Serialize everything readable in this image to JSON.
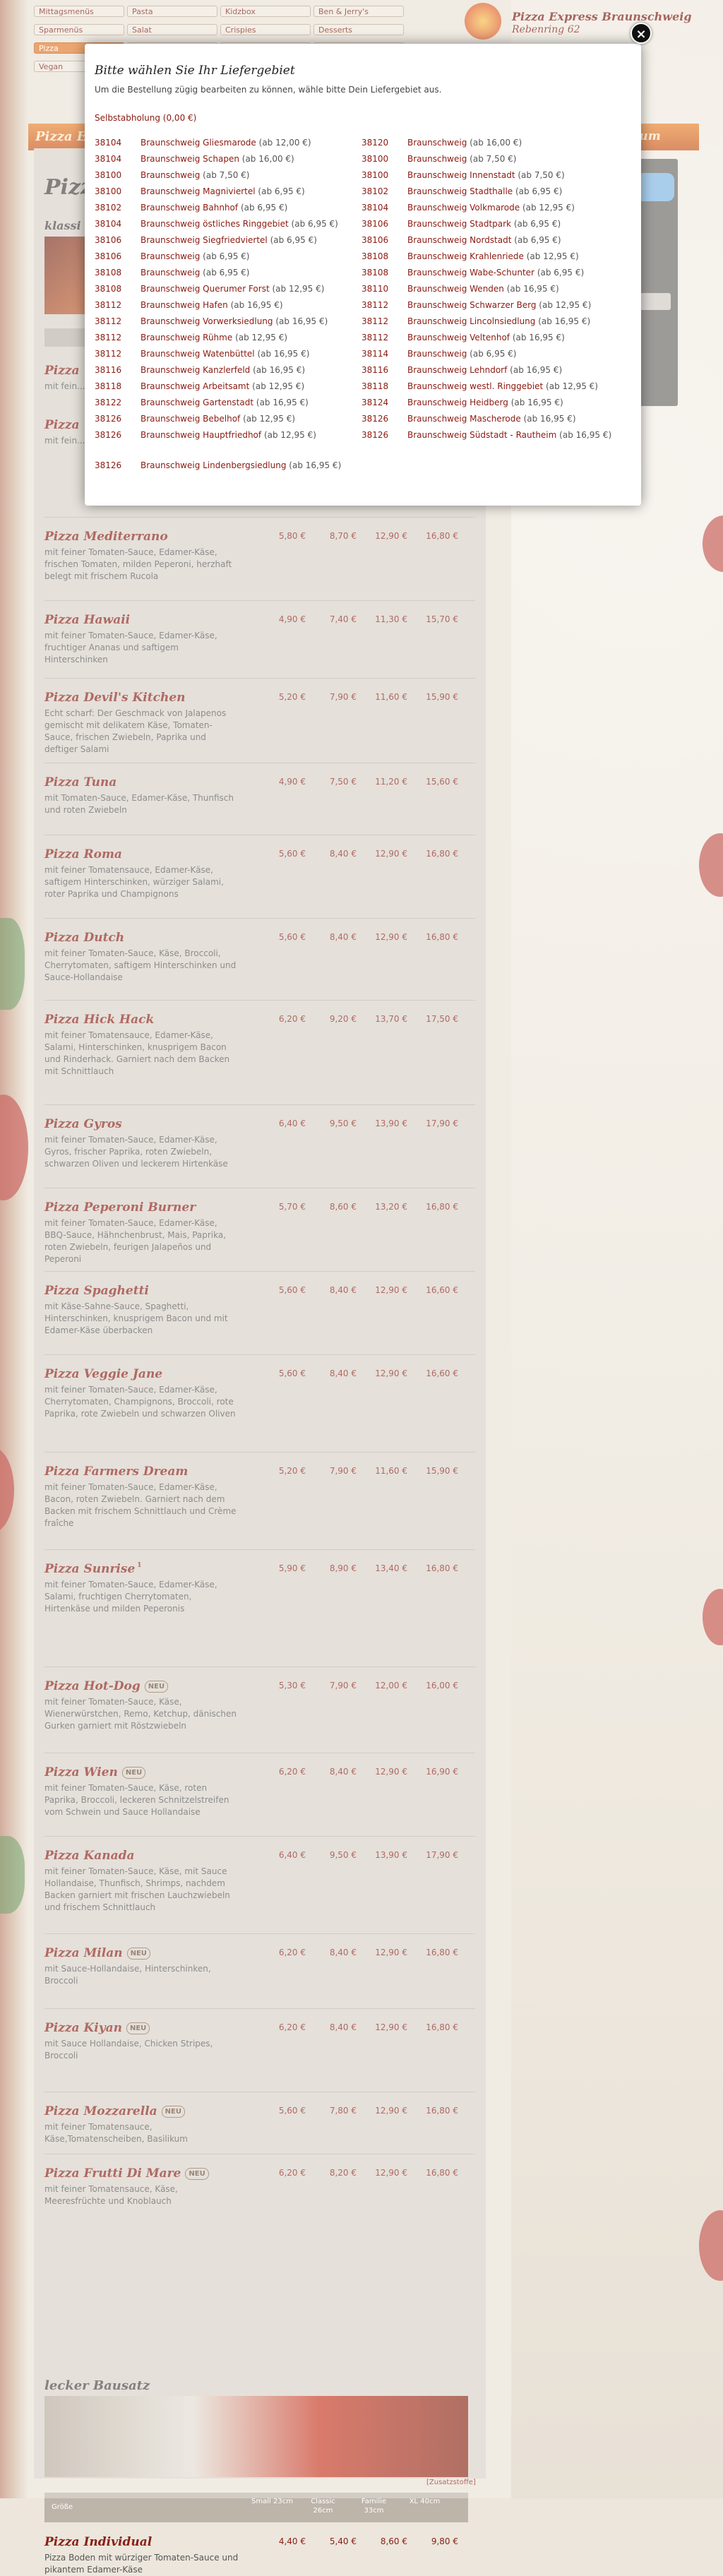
{
  "header": {
    "brand_name": "Pizza Express Braunschweig",
    "brand_street": "Rebenring 62",
    "menu": [
      "Mittagsmenüs",
      "Pasta",
      "Kidzbox",
      "Ben & Jerry's",
      "Sparmenüs",
      "Salat",
      "Crispies",
      "Desserts",
      "Pizza",
      "",
      "",
      "",
      "Vegan",
      "",
      "",
      ""
    ],
    "active_menu": "Pizza",
    "band_title": "Pizza E",
    "band_right": "reissum"
  },
  "modal": {
    "title": "Bitte wählen Sie Ihr Liefergebiet",
    "subtitle": "Um die Bestellung zügig bearbeiten zu können, wähle bitte Dein Liefergebiet aus.",
    "pickup": "Selbstabholung (0,00 €)",
    "close_symbol": "×",
    "left_column": [
      {
        "zip": "38104",
        "city": "Braunschweig Gliesmarode",
        "min": "(ab 12,00 €)"
      },
      {
        "zip": "38104",
        "city": "Braunschweig Schapen",
        "min": "(ab 16,00 €)"
      },
      {
        "zip": "38100",
        "city": "Braunschweig",
        "min": "(ab 7,50 €)"
      },
      {
        "zip": "38100",
        "city": "Braunschweig Magniviertel",
        "min": "(ab 6,95 €)"
      },
      {
        "zip": "38102",
        "city": "Braunschweig Bahnhof",
        "min": "(ab 6,95 €)"
      },
      {
        "zip": "38104",
        "city": "Braunschweig östliches Ringgebiet",
        "min": "(ab 6,95 €)"
      },
      {
        "zip": "38106",
        "city": "Braunschweig Siegfriedviertel",
        "min": "(ab 6,95 €)"
      },
      {
        "zip": "38106",
        "city": "Braunschweig",
        "min": "(ab 6,95 €)"
      },
      {
        "zip": "38108",
        "city": "Braunschweig",
        "min": "(ab 6,95 €)"
      },
      {
        "zip": "38108",
        "city": "Braunschweig Querumer Forst",
        "min": "(ab 12,95 €)"
      },
      {
        "zip": "38112",
        "city": "Braunschweig Hafen",
        "min": "(ab 16,95 €)"
      },
      {
        "zip": "38112",
        "city": "Braunschweig Vorwerksiedlung",
        "min": "(ab 16,95 €)"
      },
      {
        "zip": "38112",
        "city": "Braunschweig Rühme",
        "min": "(ab 12,95 €)"
      },
      {
        "zip": "38112",
        "city": "Braunschweig Watenbüttel",
        "min": "(ab 16,95 €)"
      },
      {
        "zip": "38116",
        "city": "Braunschweig Kanzlerfeld",
        "min": "(ab 16,95 €)"
      },
      {
        "zip": "38118",
        "city": "Braunschweig Arbeitsamt",
        "min": "(ab 12,95 €)"
      },
      {
        "zip": "38122",
        "city": "Braunschweig Gartenstadt",
        "min": "(ab 16,95 €)"
      },
      {
        "zip": "38126",
        "city": "Braunschweig Bebelhof",
        "min": "(ab 12,95 €)"
      },
      {
        "zip": "38126",
        "city": "Braunschweig Hauptfriedhof",
        "min": "(ab 12,95 €)"
      },
      {
        "zip": "38126",
        "city": "Braunschweig Lindenbergsiedlung",
        "min": "(ab 16,95 €)"
      }
    ],
    "right_column": [
      {
        "zip": "38120",
        "city": "Braunschweig",
        "min": "(ab 16,00 €)"
      },
      {
        "zip": "38100",
        "city": "Braunschweig",
        "min": "(ab 7,50 €)"
      },
      {
        "zip": "38100",
        "city": "Braunschweig Innenstadt",
        "min": "(ab 7,50 €)"
      },
      {
        "zip": "38102",
        "city": "Braunschweig Stadthalle",
        "min": "(ab 6,95 €)"
      },
      {
        "zip": "38104",
        "city": "Braunschweig Volkmarode",
        "min": "(ab 12,95 €)"
      },
      {
        "zip": "38106",
        "city": "Braunschweig Stadtpark",
        "min": "(ab 6,95 €)"
      },
      {
        "zip": "38106",
        "city": "Braunschweig Nordstadt",
        "min": "(ab 6,95 €)"
      },
      {
        "zip": "38108",
        "city": "Braunschweig Krahlenriede",
        "min": "(ab 12,95 €)"
      },
      {
        "zip": "38108",
        "city": "Braunschweig Wabe-Schunter",
        "min": "(ab 6,95 €)"
      },
      {
        "zip": "38110",
        "city": "Braunschweig Wenden",
        "min": "(ab 16,95 €)"
      },
      {
        "zip": "38112",
        "city": "Braunschweig Schwarzer Berg",
        "min": "(ab 12,95 €)"
      },
      {
        "zip": "38112",
        "city": "Braunschweig Lincolnsiedlung",
        "min": "(ab 16,95 €)"
      },
      {
        "zip": "38112",
        "city": "Braunschweig Veltenhof",
        "min": "(ab 16,95 €)"
      },
      {
        "zip": "38114",
        "city": "Braunschweig",
        "min": "(ab 6,95 €)"
      },
      {
        "zip": "38116",
        "city": "Braunschweig Lehndorf",
        "min": "(ab 16,95 €)"
      },
      {
        "zip": "38118",
        "city": "Braunschweig westl. Ringgebiet",
        "min": "(ab 12,95 €)"
      },
      {
        "zip": "38124",
        "city": "Braunschweig Heidberg",
        "min": "(ab 16,95 €)"
      },
      {
        "zip": "38126",
        "city": "Braunschweig Mascherode",
        "min": "(ab 16,95 €)"
      },
      {
        "zip": "38126",
        "city": "Braunschweig Südstadt - Rautheim",
        "min": "(ab 16,95 €)"
      }
    ]
  },
  "main": {
    "title": "Pizza",
    "subtitle": "klassi",
    "items": [
      {
        "name": "Pizza",
        "neu": false,
        "sup": "",
        "desc": "mit fein... mit ent...",
        "prices": [
          "",
          "",
          "",
          ""
        ]
      },
      {
        "name": "Pizza",
        "neu": false,
        "sup": "",
        "desc": "mit fein... deftiger ... Peperon...",
        "prices": [
          "",
          "",
          "",
          ""
        ]
      },
      {
        "name": "Pizza Mediterrano",
        "neu": false,
        "sup": "",
        "desc": "mit feiner Tomaten-Sauce, Edamer-Käse, frischen Tomaten, milden Peperoni, herzhaft belegt mit frischem Rucola",
        "prices": [
          "5,80 €",
          "8,70 €",
          "12,90 €",
          "16,80 €"
        ]
      },
      {
        "name": "Pizza Hawaii",
        "neu": false,
        "sup": "",
        "desc": "mit feiner Tomaten-Sauce, Edamer-Käse, fruchtiger Ananas und saftigem Hinterschinken",
        "prices": [
          "4,90 €",
          "7,40 €",
          "11,30 €",
          "15,70 €"
        ]
      },
      {
        "name": "Pizza Devil's Kitchen",
        "neu": false,
        "sup": "",
        "desc": "Echt scharf: Der Geschmack von Jalapenos gemischt mit delikatem Käse, Tomaten-Sauce, frischen Zwiebeln, Paprika und deftiger Salami",
        "prices": [
          "5,20 €",
          "7,90 €",
          "11,60 €",
          "15,90 €"
        ]
      },
      {
        "name": "Pizza Tuna",
        "neu": false,
        "sup": "",
        "desc": "mit Tomaten-Sauce, Edamer-Käse, Thunfisch und roten Zwiebeln",
        "prices": [
          "4,90 €",
          "7,50 €",
          "11,20 €",
          "15,60 €"
        ]
      },
      {
        "name": "Pizza Roma",
        "neu": false,
        "sup": "",
        "desc": "mit feiner Tomatensauce, Edamer-Käse, saftigem Hinterschinken, würziger Salami, roter Paprika und Champignons",
        "prices": [
          "5,60 €",
          "8,40 €",
          "12,90 €",
          "16,80 €"
        ]
      },
      {
        "name": "Pizza Dutch",
        "neu": false,
        "sup": "",
        "desc": "mit feiner Tomaten-Sauce, Käse, Broccoli, Cherrytomaten, saftigem Hinterschinken und Sauce-Hollandaise",
        "prices": [
          "5,60 €",
          "8,40 €",
          "12,90 €",
          "16,80 €"
        ]
      },
      {
        "name": "Pizza Hick Hack",
        "neu": false,
        "sup": "",
        "desc": "mit feiner Tomatensauce, Edamer-Käse, Salami, Hinterschinken, knusprigem Bacon und Rinderhack. Garniert nach dem Backen mit Schnittlauch",
        "prices": [
          "6,20 €",
          "9,20 €",
          "13,70 €",
          "17,50 €"
        ]
      },
      {
        "name": "Pizza Gyros",
        "neu": false,
        "sup": "",
        "desc": "mit feiner Tomaten-Sauce, Edamer-Käse, Gyros, frischer Paprika, roten Zwiebeln, schwarzen Oliven und leckerem Hirtenkäse",
        "prices": [
          "6,40 €",
          "9,50 €",
          "13,90 €",
          "17,90 €"
        ]
      },
      {
        "name": "Pizza Peperoni Burner",
        "neu": false,
        "sup": "",
        "desc": "mit feiner Tomaten-Sauce, Edamer-Käse, BBQ-Sauce, Hähnchenbrust, Mais, Paprika, roten Zwiebeln, feurigen Jalapeños und Peperoni",
        "prices": [
          "5,70 €",
          "8,60 €",
          "13,20 €",
          "16,80 €"
        ]
      },
      {
        "name": "Pizza Spaghetti",
        "neu": false,
        "sup": "",
        "desc": "mit Käse-Sahne-Sauce, Spaghetti, Hinterschinken, knusprigem Bacon und mit Edamer-Käse überbacken",
        "prices": [
          "5,60 €",
          "8,40 €",
          "12,90 €",
          "16,60 €"
        ]
      },
      {
        "name": "Pizza Veggie Jane",
        "neu": false,
        "sup": "",
        "desc": "mit feiner Tomaten-Sauce, Edamer-Käse, Cherrytomaten, Champignons, Broccoli, rote Paprika, rote Zwiebeln und schwarzen Oliven",
        "prices": [
          "5,60 €",
          "8,40 €",
          "12,90 €",
          "16,60 €"
        ]
      },
      {
        "name": "Pizza Farmers Dream",
        "neu": false,
        "sup": "",
        "desc": "mit feiner Tomaten-Sauce, Edamer-Käse, Bacon, roten Zwiebeln. Garniert nach dem Backen mit frischem Schnittlauch und Crème fraîche",
        "prices": [
          "5,20 €",
          "7,90 €",
          "11,60 €",
          "15,90 €"
        ]
      },
      {
        "name": "Pizza Sunrise",
        "neu": false,
        "sup": "1",
        "desc": "mit feiner Tomaten-Sauce, Edamer-Käse, Salami, fruchtigen Cherrytomaten, Hirtenkäse und milden Peperonis",
        "prices": [
          "5,90 €",
          "8,90 €",
          "13,40 €",
          "16,80 €"
        ]
      },
      {
        "name": "Pizza Hot-Dog",
        "neu": true,
        "sup": "",
        "desc": "mit feiner Tomaten-Sauce, Käse, Wienerwürstchen, Remo, Ketchup, dänischen Gurken garniert mit Röstzwiebeln",
        "prices": [
          "5,30 €",
          "7,90 €",
          "12,00 €",
          "16,00 €"
        ]
      },
      {
        "name": "Pizza Wien",
        "neu": true,
        "sup": "",
        "desc": "mit feiner Tomaten-Sauce, Käse, roten Paprika, Broccoli, leckeren Schnitzelstreifen vom Schwein und Sauce Hollandaise",
        "prices": [
          "6,20 €",
          "8,40 €",
          "12,90 €",
          "16,90 €"
        ]
      },
      {
        "name": "Pizza Kanada",
        "neu": false,
        "sup": "",
        "desc": "mit feiner Tomaten-Sauce, Käse, mit Sauce Hollandaise, Thunfisch, Shrimps, nachdem Backen garniert mit frischen Lauchzwiebeln und frischem Schnittlauch",
        "prices": [
          "6,40 €",
          "9,50 €",
          "13,90 €",
          "17,90 €"
        ]
      },
      {
        "name": "Pizza Milan",
        "neu": true,
        "sup": "",
        "desc": "mit Sauce-Hollandaise, Hinterschinken, Broccoli",
        "prices": [
          "6,20 €",
          "8,40 €",
          "12,90 €",
          "16,80 €"
        ]
      },
      {
        "name": "Pizza Kiyan",
        "neu": true,
        "sup": "",
        "desc": "mit Sauce Hollandaise, Chicken Stripes, Broccoli",
        "prices": [
          "6,20 €",
          "8,40 €",
          "12,90 €",
          "16,80 €"
        ]
      },
      {
        "name": "Pizza Mozzarella",
        "neu": true,
        "sup": "",
        "desc": "mit feiner Tomatensauce, Käse,Tomatenscheiben, Basilikum",
        "prices": [
          "5,60 €",
          "7,80 €",
          "12,90 €",
          "16,80 €"
        ]
      },
      {
        "name": "Pizza Frutti Di Mare",
        "neu": true,
        "sup": "",
        "desc": "mit feiner Tomatensauce, Käse, Meeresfrüchte und Knoblauch",
        "prices": [
          "6,20 €",
          "8,20 €",
          "12,90 €",
          "16,80 €"
        ]
      }
    ],
    "neu_label": "NEU",
    "section2": {
      "title": "lecker Bausatz",
      "headers": [
        "Größe",
        "Small 23cm",
        "Classic 26cm",
        "Familie 33cm",
        "XL 40cm"
      ],
      "item": {
        "name": "Pizza Individual",
        "desc": "Pizza Boden mit würziger Tomaten-Sauce und pikantem Edamer-Käse",
        "prices": [
          "4,40 €",
          "5,40 €",
          "8,60 €",
          "9,80 €"
        ]
      }
    },
    "footer_link": "[Zusatzstoffe]"
  },
  "colors": {
    "accent": "#8a1a10",
    "band": "#d8661f",
    "overlay": "rgba(255,255,255,0.33)"
  }
}
